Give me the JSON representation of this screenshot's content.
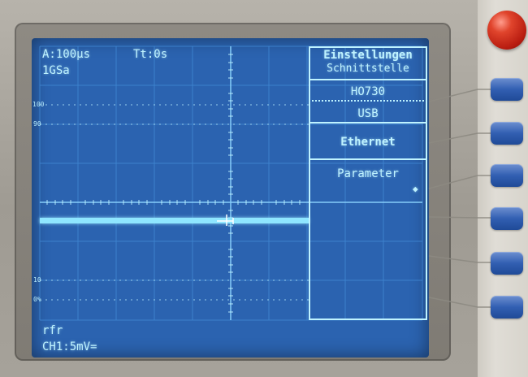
{
  "header": {
    "time_base": "A:100µs",
    "trigger_time": "Tt:0s",
    "sample_rate": "1GSa"
  },
  "menu": {
    "title": "Einstellungen",
    "subtitle": "Schnittstelle",
    "items": [
      {
        "label": "HO730"
      },
      {
        "label": "USB"
      },
      {
        "label": "Ethernet"
      },
      {
        "label": "Parameter"
      }
    ],
    "arrow_glyph": "◆"
  },
  "graticule": {
    "label_100": "100",
    "label_90": "90",
    "label_10": "10",
    "label_0": "0%"
  },
  "footer": {
    "mode": "rfr",
    "channel": "CH1:5mV="
  },
  "colors": {
    "screen_bg": "#2b63b0",
    "trace": "#8fe6ff",
    "text": "#bff3ff",
    "power_button": "#d8351f",
    "softkey": "#325fb2"
  },
  "icons": {
    "power": "power-button-icon",
    "softkeys": "softkey-icon",
    "parameter_arrow": "diamond-arrow-icon"
  }
}
